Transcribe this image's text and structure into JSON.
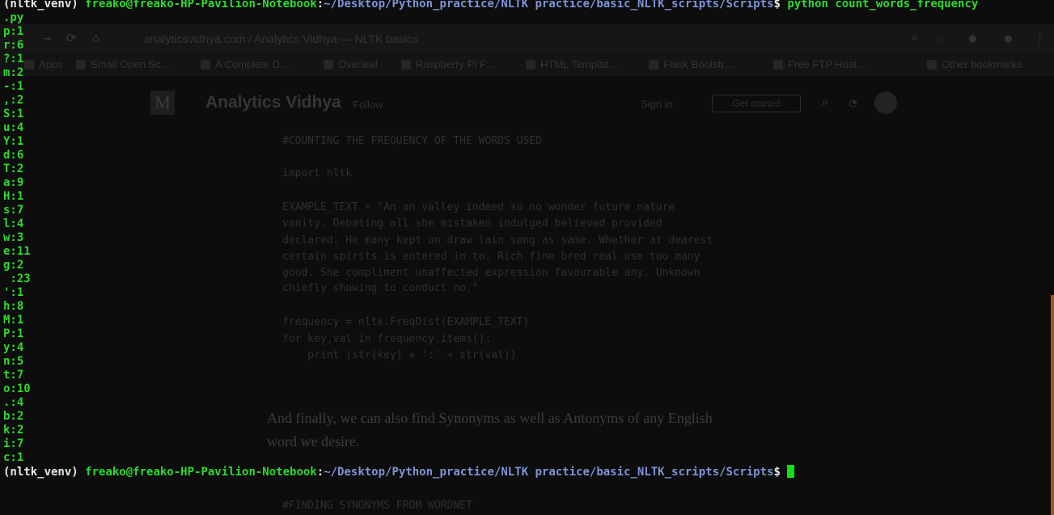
{
  "background_browser": {
    "url_text": "analyticsvidhya.com / Analytics Vidhya — NLTK basics",
    "bookmarks": [
      "Apps",
      "Small Open Sc…",
      "A Complete D…",
      "Overleaf",
      "Raspberry Pi F…",
      "HTML Templat…",
      "Flask Bootstr…",
      "Free FTP Host…",
      "Other bookmarks"
    ],
    "publication_name": "Analytics Vidhya",
    "follow_label": "Follow",
    "sign_in_label": "Sign in",
    "get_started_label": "Get started",
    "code_lines": [
      "#COUNTING THE FREQUENCY OF THE WORDS USED",
      "import nltk",
      "EXAMPLE_TEXT = \"An an valley indeed so no wonder future nature",
      "vanity. Debating all she mistaken indulged believed provided",
      "declared. He many kept on draw lain song as same. Whether at dearest",
      "certain spirits is entered in to. Rich fine bred real use too many",
      "good. She compliment unaffected expression favourable any. Unknown",
      "chiefly showing to conduct no.\"",
      "frequency = nltk.FreqDist(EXAMPLE_TEXT)",
      "for key,val in frequency.items():",
      "    print (str(key) + ':' + str(val))"
    ],
    "prose_lines": [
      "And finally, we can also find Synonyms as well as Antonyms of any English",
      "word we desire."
    ],
    "code_heading_2": "#FINDING SYNONYMS FROM WORDNET"
  },
  "terminal": {
    "prompt": {
      "env": "(nltk_venv) ",
      "user_host": "freako@freako-HP-Pavilion-Notebook",
      "separator": ":",
      "path": "~/Desktop/Python_practice/NLTK practice/basic_NLTK_scripts/Scripts",
      "symbol": "$ "
    },
    "command": "python count_words_frequency",
    "command_wrap": ".py",
    "output": [
      "p:1",
      "r:6",
      "?:1",
      "m:2",
      "-:1",
      ",:2",
      "S:1",
      "u:4",
      "Y:1",
      "d:6",
      "T:2",
      "a:9",
      "H:1",
      "s:7",
      "l:4",
      "w:3",
      "e:11",
      "g:2",
      " :23",
      "':1",
      "h:8",
      "M:1",
      "P:1",
      "y:4",
      "n:5",
      "t:7",
      "o:10",
      ".:4",
      "b:2",
      "k:2",
      "i:7",
      "c:1"
    ]
  },
  "colors": {
    "terminal_bg": "#0d0d0d",
    "prompt_green": "#2fd82f",
    "path_blue": "#7d94d8",
    "scrollbar_orange": "#b0521e"
  }
}
